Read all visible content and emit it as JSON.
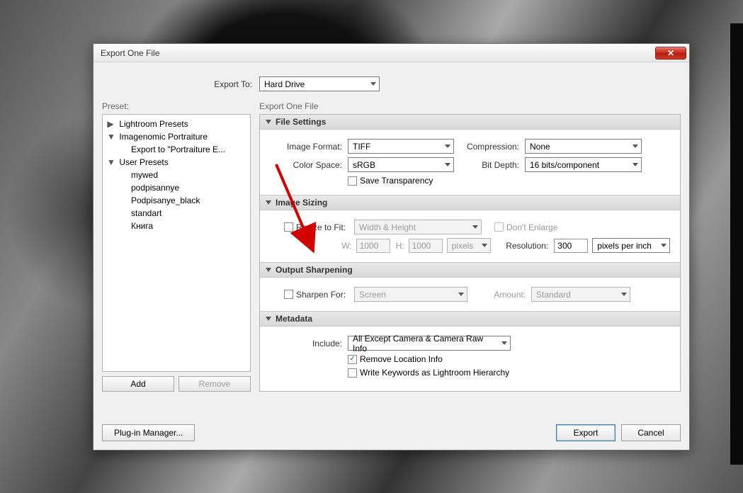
{
  "dialog": {
    "title": "Export One File",
    "export_to_label": "Export To:",
    "export_to_value": "Hard Drive",
    "preset_label": "Preset:",
    "right_label": "Export One File",
    "plugin_mgr": "Plug-in Manager...",
    "export_btn": "Export",
    "cancel_btn": "Cancel",
    "add_btn": "Add",
    "remove_btn": "Remove"
  },
  "presets": {
    "groups": [
      {
        "label": "Lightroom Presets",
        "expanded": false,
        "children": []
      },
      {
        "label": "Imagenomic Portraiture",
        "expanded": true,
        "children": [
          "Export to \"Portraiture E..."
        ]
      },
      {
        "label": "User Presets",
        "expanded": true,
        "children": [
          "mywed",
          "podpisannye",
          "Podpisanye_black",
          "standart",
          "Книга"
        ]
      }
    ]
  },
  "sections": {
    "file_settings": {
      "title": "File Settings",
      "image_format_label": "Image Format:",
      "image_format_value": "TIFF",
      "compression_label": "Compression:",
      "compression_value": "None",
      "color_space_label": "Color Space:",
      "color_space_value": "sRGB",
      "bit_depth_label": "Bit Depth:",
      "bit_depth_value": "16 bits/component",
      "save_transparency": "Save Transparency"
    },
    "image_sizing": {
      "title": "Image Sizing",
      "resize_label": "Resize to Fit:",
      "resize_value": "Width & Height",
      "dont_enlarge": "Don't Enlarge",
      "w_label": "W:",
      "w_value": "1000",
      "h_label": "H:",
      "h_value": "1000",
      "units_value": "pixels",
      "resolution_label": "Resolution:",
      "resolution_value": "300",
      "resolution_units": "pixels per inch"
    },
    "output_sharpen": {
      "title": "Output Sharpening",
      "sharpen_for_label": "Sharpen For:",
      "sharpen_for_value": "Screen",
      "amount_label": "Amount:",
      "amount_value": "Standard"
    },
    "metadata": {
      "title": "Metadata",
      "include_label": "Include:",
      "include_value": "All Except Camera & Camera Raw Info",
      "remove_location": "Remove Location Info",
      "write_keywords": "Write Keywords as Lightroom Hierarchy"
    }
  }
}
